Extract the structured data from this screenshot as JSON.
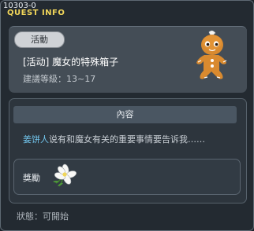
{
  "window": {
    "quest_id": "10303-0",
    "title": "QUEST INFO"
  },
  "quest": {
    "category_badge": "活動",
    "name": "[活动] 魔女的特殊箱子",
    "level_text": "建議等級：13~17"
  },
  "content": {
    "header": "內容",
    "npc_name": "姜饼人",
    "text": "说有和魔女有关的重要事情要告诉我……"
  },
  "reward": {
    "label": "獎勵",
    "item_icon": "white-flower-icon"
  },
  "status": {
    "text": "狀態：可開始"
  },
  "colors": {
    "title": "#f1d65a",
    "npc_name": "#72c6ee",
    "window_bg": "#232a31"
  }
}
